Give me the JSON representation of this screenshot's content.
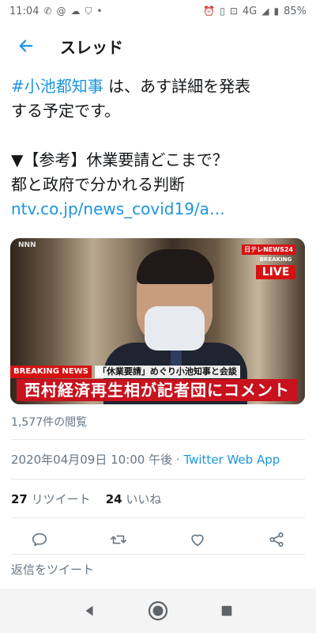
{
  "status_bar": {
    "time": "11:04",
    "network": "4G",
    "battery": "85%"
  },
  "header": {
    "title": "スレッド"
  },
  "tweet": {
    "hashtag": "#小池都知事",
    "text_line1_rest": "は、あす詳細を発表",
    "text_line2": "する予定です。",
    "ref_line1": "▼【参考】休業要請どこまで？",
    "ref_line2": "都と政府で分かれる判断",
    "link": "ntv.co.jp/news_covid19/a…"
  },
  "media": {
    "logo": "NNN",
    "channel": "日テレNEWS24",
    "breaking_small": "BREAKING",
    "live": "LIVE",
    "breaking_tag": "BREAKING NEWS",
    "breaking_sub": "「休業要請」めぐり小池知事と会談",
    "headline": "西村経済再生相が記者団にコメント"
  },
  "views": "1,577件の閲覧",
  "meta": {
    "timestamp": "2020年04月09日 10:00 午後",
    "separator": " · ",
    "app": "Twitter Web App"
  },
  "stats": {
    "retweets": "27",
    "retweets_label": "リツイート",
    "likes": "24",
    "likes_label": "いいね"
  },
  "reply_placeholder": "返信をツイート",
  "colors": {
    "accent": "#1b95e0",
    "text": "#14171a",
    "muted": "#657786",
    "breaking_red": "#c8121e"
  }
}
